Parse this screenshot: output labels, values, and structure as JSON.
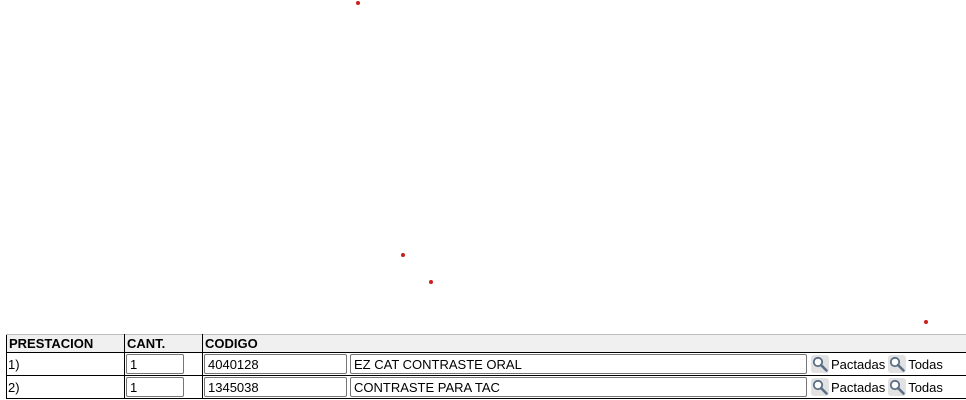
{
  "table": {
    "headers": {
      "prestacion": "PRESTACION",
      "cant": "CANT.",
      "codigo": "CODIGO"
    },
    "rows": [
      {
        "index": "1)",
        "cant": "1",
        "codigo": "4040128",
        "descripcion": "EZ CAT CONTRASTE ORAL",
        "pactadas_label": "Pactadas",
        "todas_label": "Todas"
      },
      {
        "index": "2)",
        "cant": "1",
        "codigo": "1345038",
        "descripcion": "CONTRASTE PARA TAC",
        "pactadas_label": "Pactadas",
        "todas_label": "Todas"
      }
    ]
  },
  "icons": {
    "lookup": "magnifier-icon"
  },
  "colors": {
    "marker_dot": "#cc1f1f",
    "header_bg": "#f0f0f0"
  }
}
